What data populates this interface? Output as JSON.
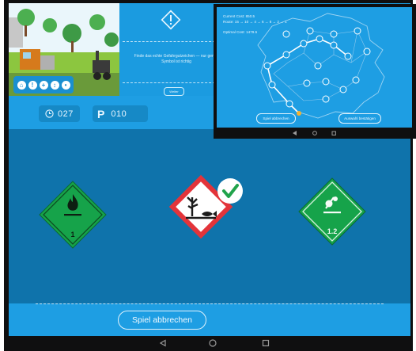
{
  "main": {
    "timer_value": "027",
    "points_prefix": "P",
    "points_value": "010",
    "cancel_label": "Spiel abbrechen",
    "signs": [
      {
        "kind": "flammable-liquid",
        "class_number": "1"
      },
      {
        "kind": "environmentally-hazardous",
        "selected": true
      },
      {
        "kind": "explosive",
        "class_number": "1.2"
      }
    ]
  },
  "inset_left": {
    "instruction": "Finde das echte Gefahrgutzeichen — nur genäu Symbol ist richtig",
    "ok_label": "Weiter"
  },
  "inset_right": {
    "current_cost": "Current Cost: 850.5",
    "route": "Route: 15 → 10 → 4 → 6 → 8 → 2 → 1",
    "optimal_cost": "Optimal Cost: 1479.5",
    "cancel_label": "Spiel abbrechen",
    "confirm_label": "Auswahl bestätigen"
  },
  "colors": {
    "app_blue": "#1e9ee3",
    "field_blue": "#0f73ab",
    "ghs_green": "#16a34a",
    "ghs_red": "#e3343a"
  }
}
